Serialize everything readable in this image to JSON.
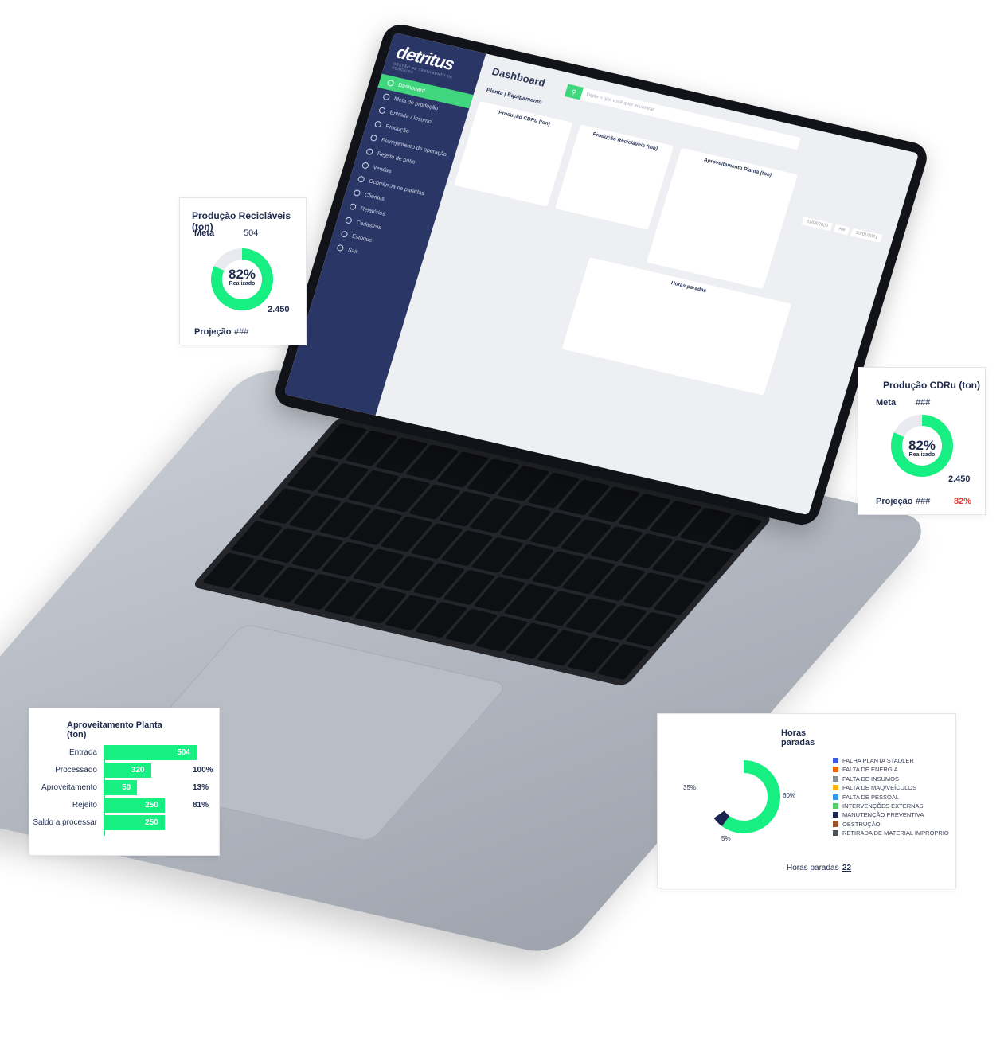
{
  "screen": {
    "brand": "detritus",
    "brand_subtitle": "GESTÃO DE TRATAMENTO DE RESÍDUOS",
    "nav": [
      {
        "label": "Dashboard",
        "active": true,
        "icon": "monitor-icon"
      },
      {
        "label": "Meta de produção",
        "icon": "target-icon"
      },
      {
        "label": "Entrada / Insumo",
        "icon": "input-icon"
      },
      {
        "label": "Produção",
        "icon": "gear-icon"
      },
      {
        "label": "Planejamento de operação",
        "icon": "calendar-icon"
      },
      {
        "label": "Rejeito de pátio",
        "icon": "reject-icon"
      },
      {
        "label": "Vendas",
        "icon": "cash-icon"
      },
      {
        "label": "Ocorrência de paradas",
        "icon": "alert-icon"
      },
      {
        "label": "Clientes",
        "icon": "users-icon"
      },
      {
        "label": "Relatórios",
        "icon": "report-icon"
      },
      {
        "label": "Cadastros",
        "icon": "folder-icon"
      },
      {
        "label": "Estoque",
        "icon": "box-icon"
      },
      {
        "label": "Sair",
        "icon": "logout-icon"
      }
    ],
    "title": "Dashboard",
    "search_placeholder": "Digite o que você quer encontrar",
    "subtitle": "Planta | Equipamento",
    "date_from": "01/08/2020",
    "date_sep": "Até",
    "date_to": "30/01/2021"
  },
  "card_reciclaveis": {
    "title": "Produção Recicláveis (ton)",
    "meta_label": "Meta",
    "meta_value": "504",
    "pct": "82%",
    "pct_sub": "Realizado",
    "realizado_value": "2.450",
    "projecao_label": "Projeção",
    "projecao_value": "###",
    "fill": 0.82,
    "color": "#17ef82"
  },
  "card_cdru": {
    "title": "Produção CDRu (ton)",
    "meta_label": "Meta",
    "meta_value": "###",
    "pct": "82%",
    "pct_sub": "Realizado",
    "realizado_value": "2.450",
    "projecao_label": "Projeção",
    "projecao_value": "###",
    "projecao_pct": "82%",
    "fill": 0.82,
    "color": "#17ef82"
  },
  "card_aproveitamento": {
    "title": "Aproveitamento Planta (ton)",
    "rows": [
      {
        "label": "Entrada",
        "value": "504",
        "pct": "",
        "frac": 1.0
      },
      {
        "label": "Processado",
        "value": "320",
        "pct": "100%",
        "frac": 0.5
      },
      {
        "label": "Aproveitamento",
        "value": "50",
        "pct": "13%",
        "frac": 0.35
      },
      {
        "label": "Rejeito",
        "value": "250",
        "pct": "81%",
        "frac": 0.65
      },
      {
        "label": "Saldo a processar",
        "value": "250",
        "pct": "",
        "frac": 0.65
      }
    ]
  },
  "card_horas": {
    "title": "Horas paradas",
    "pct_left": "35%",
    "pct_right": "60%",
    "pct_bottom": "5%",
    "legend": [
      {
        "label": "FALHA PLANTA STADLER",
        "color": "#3b5bdb"
      },
      {
        "label": "FALTA DE ENERGIA",
        "color": "#f76707"
      },
      {
        "label": "FALTA DE INSUMOS",
        "color": "#868e96"
      },
      {
        "label": "FALTA DE MAQ/VEÍCULOS",
        "color": "#fab005"
      },
      {
        "label": "FALTA DE PESSOAL",
        "color": "#339af0"
      },
      {
        "label": "INTERVENÇÕES EXTERNAS",
        "color": "#51cf66"
      },
      {
        "label": "MANUTENÇÃO PREVENTIVA",
        "color": "#1c2452"
      },
      {
        "label": "OBSTRUÇÃO",
        "color": "#a0522d"
      },
      {
        "label": "RETIRADA DE MATERIAL IMPRÓPRIO",
        "color": "#495057"
      }
    ],
    "total_label": "Horas paradas",
    "total_value": "22",
    "green_frac": 0.6,
    "navy_frac": 0.05
  }
}
